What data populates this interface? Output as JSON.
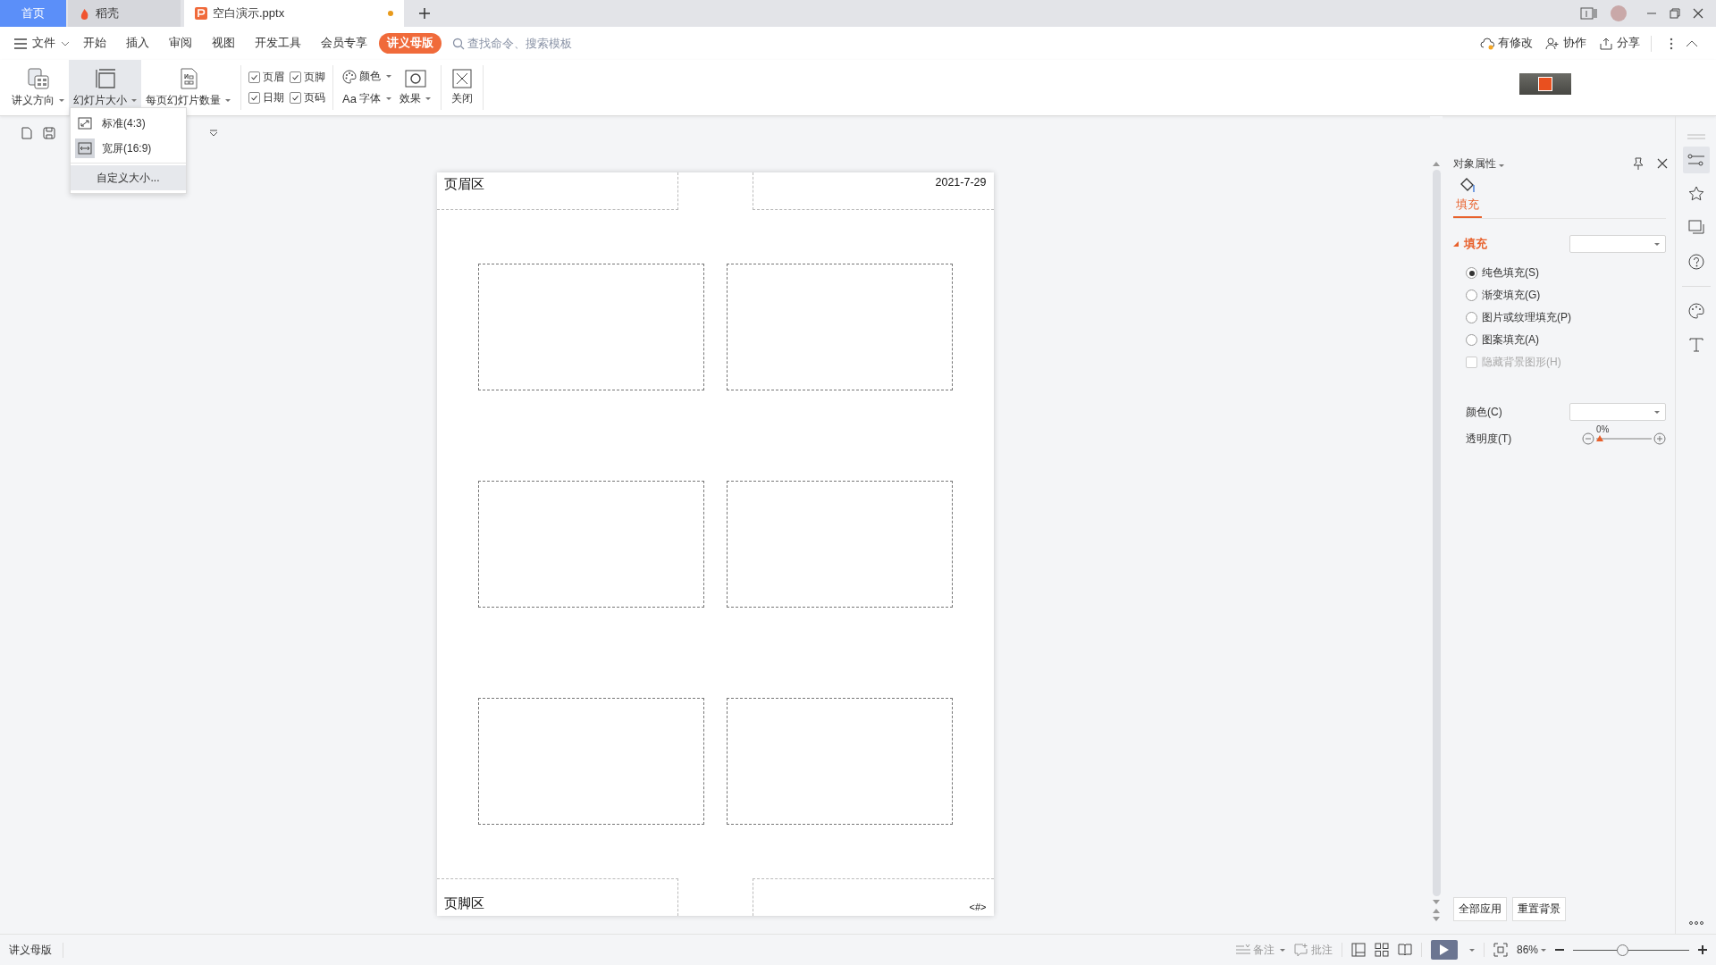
{
  "tabs": [
    {
      "kind": "home",
      "label": "首页",
      "selected": false,
      "unsaved": false
    },
    {
      "kind": "app",
      "label": "稻壳",
      "selected": false,
      "unsaved": false
    },
    {
      "kind": "document",
      "label": "空白演示.pptx",
      "selected": true,
      "unsaved": true
    }
  ],
  "menu": {
    "file": "文件",
    "items": [
      {
        "label": "开始",
        "selected": false
      },
      {
        "label": "插入",
        "selected": false
      },
      {
        "label": "审阅",
        "selected": false
      },
      {
        "label": "视图",
        "selected": false
      },
      {
        "label": "开发工具",
        "selected": false
      },
      {
        "label": "会员专享",
        "selected": false
      },
      {
        "label": "讲义母版",
        "selected": true
      }
    ],
    "search_placeholder": "查找命令、搜索模板",
    "actions": [
      "有修改",
      "协作",
      "分享"
    ]
  },
  "ribbon": {
    "buttons": [
      {
        "kind": "orientation",
        "label": "讲义方向",
        "selected": false
      },
      {
        "kind": "size",
        "label": "幻灯片大小",
        "selected": true
      },
      {
        "kind": "per_page",
        "label": "每页幻灯片数量",
        "selected": false
      }
    ],
    "checkboxes": [
      {
        "label": "页眉",
        "checked": true
      },
      {
        "label": "页脚",
        "checked": true
      },
      {
        "label": "日期",
        "checked": true
      },
      {
        "label": "页码",
        "checked": true
      }
    ],
    "color_label": "颜色",
    "font_glyph": "Aa",
    "font_label": "字体",
    "effects_label": "效果",
    "close_label": "关闭"
  },
  "size_menu": [
    {
      "kind": "standard",
      "label": "标准(4:3)",
      "selected": false,
      "hovered": false
    },
    {
      "kind": "wide",
      "label": "宽屏(16:9)",
      "selected": true,
      "hovered": false
    },
    {
      "kind": "custom",
      "label": "自定义大小...",
      "selected": false,
      "hovered": true
    }
  ],
  "slide": {
    "header": "页眉区",
    "date": "2021-7-29",
    "footer": "页脚区",
    "page_number": "<#>"
  },
  "panel": {
    "title": "对象属性",
    "tab": "填充",
    "section": "填充",
    "fill_options": [
      {
        "label": "纯色填充(S)",
        "selected": true
      },
      {
        "label": "渐变填充(G)",
        "selected": false
      },
      {
        "label": "图片或纹理填充(P)",
        "selected": false
      },
      {
        "label": "图案填充(A)",
        "selected": false
      }
    ],
    "hide_background": {
      "label": "隐藏背景图形(H)",
      "checked": false,
      "disabled": true
    },
    "color_label": "颜色(C)",
    "transparency_label": "透明度(T)",
    "transparency": {
      "reading": "0%",
      "level": 0
    },
    "buttons": [
      "全部应用",
      "重置背景"
    ]
  },
  "status": {
    "mode": "讲义母版",
    "notes": "备注",
    "comments": "批注",
    "zoom": "86%",
    "zoom_slider": {
      "level": 0.42
    }
  }
}
